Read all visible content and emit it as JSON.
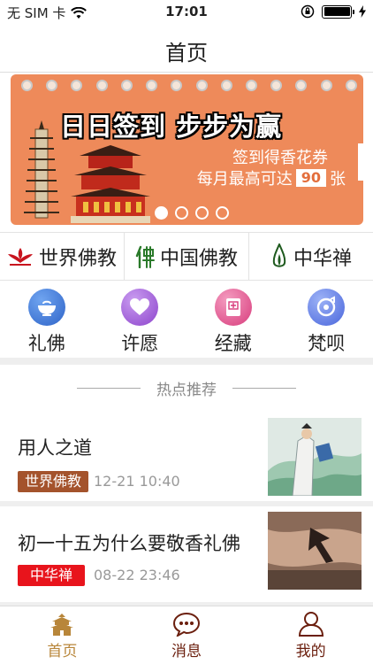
{
  "status": {
    "carrier": "无 SIM 卡",
    "time": "17:01"
  },
  "nav": {
    "title": "首页"
  },
  "banner": {
    "headline": "日日签到 步步为赢",
    "line1": "签到得香花券",
    "line2_pre": "每月最高可达",
    "line2_num": "90",
    "line2_post": "张",
    "active_dot": 0,
    "dot_count": 4
  },
  "partners": [
    {
      "label": "世界佛教",
      "icon": "lotus-logo-icon",
      "color": "#c8141e"
    },
    {
      "label": "中国佛教",
      "icon": "fo-logo-icon",
      "color": "#2a7a2a"
    },
    {
      "label": "中华禅",
      "icon": "flame-logo-icon",
      "color": "#2a6a2a"
    }
  ],
  "menu": [
    {
      "label": "礼佛",
      "icon": "offering-bowl-icon",
      "color": "#3b77d8"
    },
    {
      "label": "许愿",
      "icon": "heart-icon",
      "color": "#a15bd6"
    },
    {
      "label": "经藏",
      "icon": "sutra-book-icon",
      "color": "#e2558e"
    },
    {
      "label": "梵呗",
      "icon": "music-disc-icon",
      "color": "#5a79e6"
    }
  ],
  "section_title": "热点推荐",
  "news": [
    {
      "title": "用人之道",
      "tag": "世界佛教",
      "tag_color": "#a4532c",
      "date": "12-21 10:40"
    },
    {
      "title": "初一十五为什么要敬香礼佛",
      "tag": "中华禅",
      "tag_color": "#e8141c",
      "date": "08-22 23:46"
    }
  ],
  "tabs": [
    {
      "label": "首页",
      "icon": "temple-icon",
      "active": true
    },
    {
      "label": "消息",
      "icon": "chat-bubble-icon",
      "active": false
    },
    {
      "label": "我的",
      "icon": "user-icon",
      "active": false
    }
  ]
}
